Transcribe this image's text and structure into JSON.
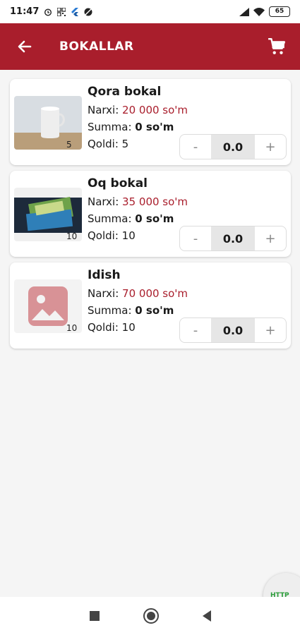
{
  "status_bar": {
    "time": "11:47",
    "battery": "65"
  },
  "app_bar": {
    "title": "BOKALLAR"
  },
  "colors": {
    "primary": "#a91e2c",
    "price": "#a91e2c"
  },
  "products": [
    {
      "name": "Qora bokal",
      "narxi_label": "Narxi: ",
      "narxi": "20 000 so'm",
      "summa_label": "Summa: ",
      "summa": "0 so'm",
      "qoldi": "Qoldi: 5",
      "thumb_count": "5",
      "minus": "-",
      "qty": "0.0",
      "plus": "+"
    },
    {
      "name": "Oq bokal",
      "narxi_label": "Narxi: ",
      "narxi": "35 000 so'm",
      "summa_label": "Summa: ",
      "summa": "0 so'm",
      "qoldi": "Qoldi: 10",
      "thumb_count": "10",
      "minus": "-",
      "qty": "0.0",
      "plus": "+"
    },
    {
      "name": "Idish",
      "narxi_label": "Narxi: ",
      "narxi": "70 000 so'm",
      "summa_label": "Summa: ",
      "summa": "0 so'm",
      "qoldi": "Qoldi: 10",
      "thumb_count": "10",
      "minus": "-",
      "qty": "0.0",
      "plus": "+"
    }
  ],
  "floating_bubble": {
    "text": "HTTP"
  },
  "icons": {
    "back": "arrow-left-icon",
    "cart": "shopping-cart-icon",
    "placeholder": "image-placeholder-icon"
  }
}
